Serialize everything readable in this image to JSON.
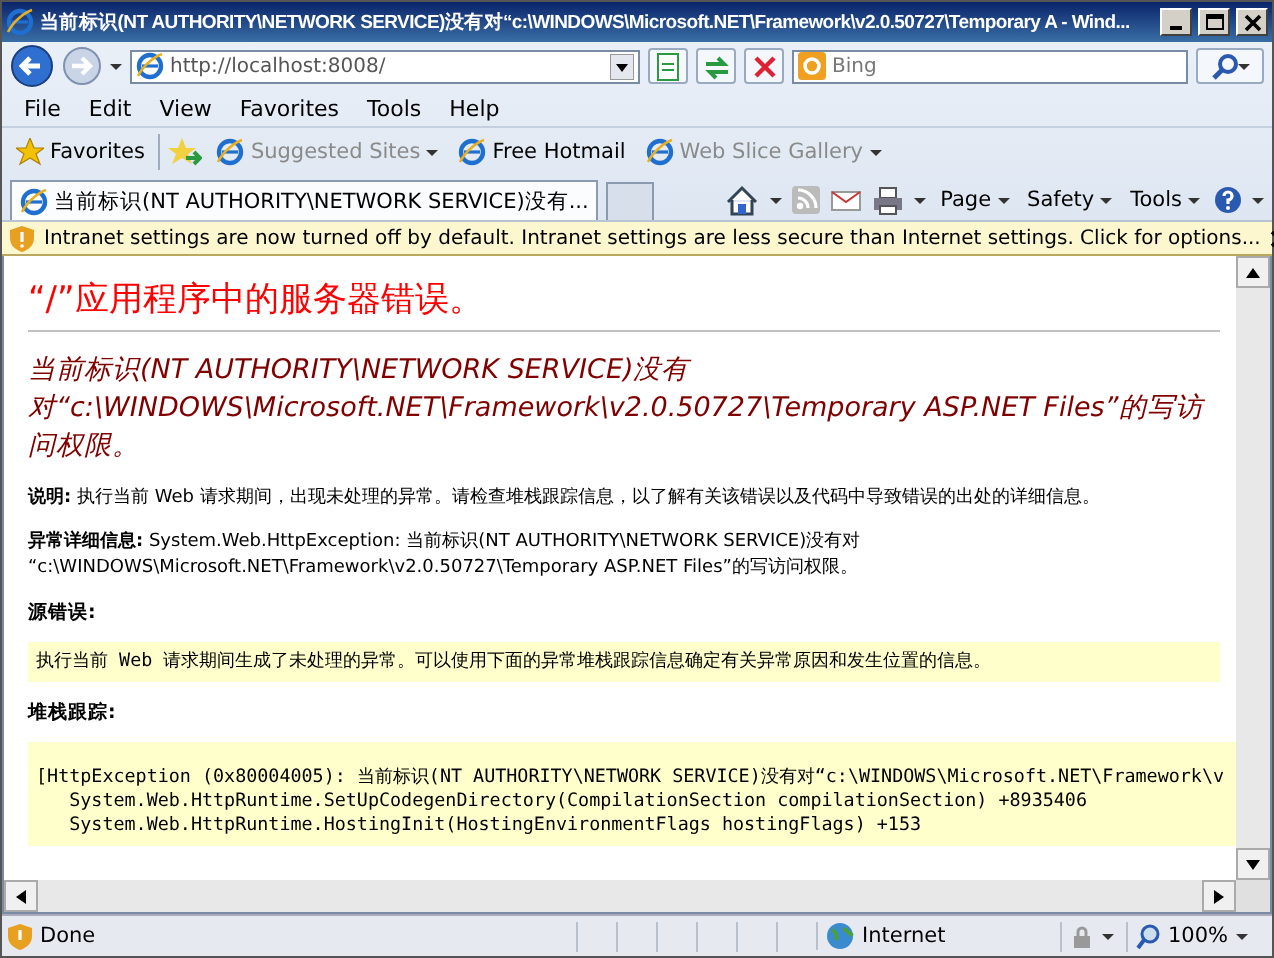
{
  "window": {
    "title": "当前标识(NT AUTHORITY\\NETWORK SERVICE)没有对“c:\\WINDOWS\\Microsoft.NET\\Framework\\v2.0.50727\\Temporary A - Wind..."
  },
  "address_bar": {
    "url": "http://localhost:8008/"
  },
  "search": {
    "placeholder": "Bing"
  },
  "menu": [
    "File",
    "Edit",
    "View",
    "Favorites",
    "Tools",
    "Help"
  ],
  "favorites_bar": {
    "label": "Favorites",
    "links": [
      {
        "label": "Suggested Sites",
        "disabled": true,
        "dropdown": true
      },
      {
        "label": "Free Hotmail",
        "disabled": false,
        "dropdown": false
      },
      {
        "label": "Web Slice Gallery",
        "disabled": true,
        "dropdown": true
      }
    ]
  },
  "tabs": [
    {
      "label": "当前标识(NT AUTHORITY\\NETWORK SERVICE)没有...",
      "selected": true
    }
  ],
  "command_bar": [
    "Page",
    "Safety",
    "Tools"
  ],
  "info_bar": {
    "message": "Intranet settings are now turned off by default. Intranet settings are less secure than Internet settings. Click for options..."
  },
  "page": {
    "heading": "“/”应用程序中的服务器错误。",
    "subheading": "当前标识(NT AUTHORITY\\NETWORK SERVICE)没有对“c:\\WINDOWS\\Microsoft.NET\\Framework\\v2.0.50727\\Temporary ASP.NET Files”的写访问权限。",
    "sections": [
      {
        "kind": "text",
        "label": "说明:",
        "text": "执行当前 Web 请求期间，出现未处理的异常。请检查堆栈跟踪信息，以了解有关该错误以及代码中导致错误的出处的详细信息。"
      },
      {
        "kind": "text",
        "label": "异常详细信息:",
        "text": "System.Web.HttpException: 当前标识(NT AUTHORITY\\NETWORK SERVICE)没有对 “c:\\WINDOWS\\Microsoft.NET\\Framework\\v2.0.50727\\Temporary ASP.NET Files”的写访问权限。"
      },
      {
        "kind": "code",
        "label": "源错误:",
        "lines": [
          "执行当前 Web 请求期间生成了未处理的异常。可以使用下面的异常堆栈跟踪信息确定有关异常原因和发生位置的信息。"
        ]
      },
      {
        "kind": "code",
        "label": "堆栈跟踪:",
        "lines": [
          "[HttpException (0x80004005): 当前标识(NT AUTHORITY\\NETWORK SERVICE)没有对“c:\\WINDOWS\\Microsoft.NET\\Framework\\v",
          "   System.Web.HttpRuntime.SetUpCodegenDirectory(CompilationSection compilationSection) +8935406",
          "   System.Web.HttpRuntime.HostingInit(HostingEnvironmentFlags hostingFlags) +153"
        ]
      }
    ]
  },
  "status_bar": {
    "status": "Done",
    "zone": "Internet",
    "zoom": "100%"
  }
}
